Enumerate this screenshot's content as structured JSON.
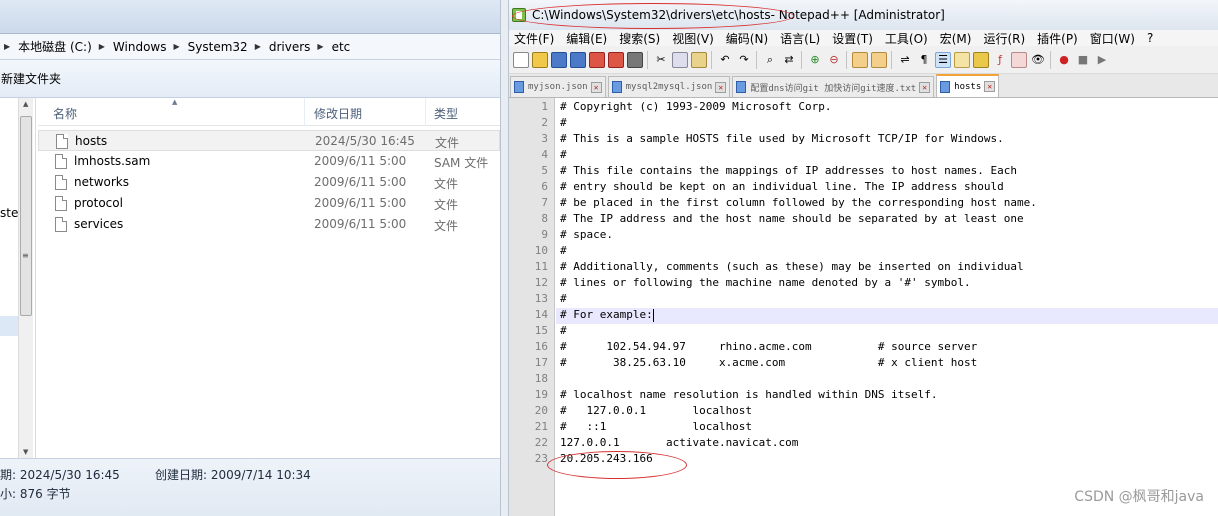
{
  "explorer": {
    "breadcrumb": [
      "本地磁盘 (C:)",
      "Windows",
      "System32",
      "drivers",
      "etc"
    ],
    "toolbar": {
      "new_folder": "新建文件夹"
    },
    "nav_partial_text": "ste",
    "columns": {
      "name": "名称",
      "date": "修改日期",
      "type": "类型"
    },
    "files": [
      {
        "name": "hosts",
        "date": "2024/5/30 16:45",
        "type": "文件"
      },
      {
        "name": "lmhosts.sam",
        "date": "2009/6/11 5:00",
        "type": "SAM 文件"
      },
      {
        "name": "networks",
        "date": "2009/6/11 5:00",
        "type": "文件"
      },
      {
        "name": "protocol",
        "date": "2009/6/11 5:00",
        "type": "文件"
      },
      {
        "name": "services",
        "date": "2009/6/11 5:00",
        "type": "文件"
      }
    ],
    "status": {
      "modified": "期: 2024/5/30 16:45",
      "created": "创建日期: 2009/7/14 10:34",
      "size": "小: 876 字节"
    }
  },
  "notepad": {
    "title_path": "C:\\Windows\\System32\\drivers\\etc\\hosts",
    "title_suffix": " - Notepad++ [Administrator]",
    "menu": [
      "文件(F)",
      "编辑(E)",
      "搜索(S)",
      "视图(V)",
      "编码(N)",
      "语言(L)",
      "设置(T)",
      "工具(O)",
      "宏(M)",
      "运行(R)",
      "插件(P)",
      "窗口(W)",
      "?"
    ],
    "tabs": [
      {
        "label": "myjson.json",
        "active": false
      },
      {
        "label": "mysql2mysql.json",
        "active": false
      },
      {
        "label": "配置dns访问git 加快访问git速度.txt",
        "active": false
      },
      {
        "label": "hosts",
        "active": true
      }
    ],
    "current_line": 14,
    "lines": [
      "# Copyright (c) 1993-2009 Microsoft Corp.",
      "#",
      "# This is a sample HOSTS file used by Microsoft TCP/IP for Windows.",
      "#",
      "# This file contains the mappings of IP addresses to host names. Each",
      "# entry should be kept on an individual line. The IP address should",
      "# be placed in the first column followed by the corresponding host name.",
      "# The IP address and the host name should be separated by at least one",
      "# space.",
      "#",
      "# Additionally, comments (such as these) may be inserted on individual",
      "# lines or following the machine name denoted by a '#' symbol.",
      "#",
      "# For example:",
      "#",
      "#      102.54.94.97     rhino.acme.com          # source server",
      "#       38.25.63.10     x.acme.com              # x client host",
      "",
      "# localhost name resolution is handled within DNS itself.",
      "#   127.0.0.1       localhost",
      "#   ::1             localhost",
      "127.0.0.1       activate.navicat.com",
      "20.205.243.166"
    ]
  },
  "watermark": "CSDN @枫哥和java"
}
